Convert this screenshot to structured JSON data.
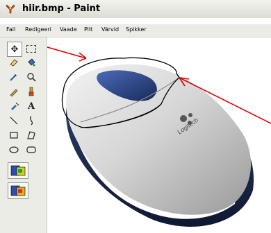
{
  "window": {
    "title": "hiir.bmp - Paint"
  },
  "menu": {
    "items": [
      "Fail",
      "Redigeeri",
      "Vaade",
      "Pilt",
      "Värvid",
      "Spikker"
    ]
  },
  "toolbox": {
    "tools": [
      {
        "name": "free-form-select-icon",
        "glyph": "✥"
      },
      {
        "name": "select-icon",
        "glyph": "▭"
      },
      {
        "name": "eraser-icon",
        "glyph": "⌫"
      },
      {
        "name": "fill-icon",
        "glyph": "♦"
      },
      {
        "name": "color-picker-icon",
        "glyph": "✎"
      },
      {
        "name": "magnifier-icon",
        "glyph": "🔍"
      },
      {
        "name": "pencil-icon",
        "glyph": "✏"
      },
      {
        "name": "brush-icon",
        "glyph": "♜"
      },
      {
        "name": "airbrush-icon",
        "glyph": "✺"
      },
      {
        "name": "text-icon",
        "glyph": "A"
      },
      {
        "name": "line-icon",
        "glyph": "╲"
      },
      {
        "name": "curve-icon",
        "glyph": "∫"
      },
      {
        "name": "rectangle-icon",
        "glyph": "□"
      },
      {
        "name": "polygon-icon",
        "glyph": "▱"
      },
      {
        "name": "ellipse-icon",
        "glyph": "◯"
      },
      {
        "name": "rounded-rectangle-icon",
        "glyph": "▢"
      }
    ]
  },
  "canvas": {
    "brand_text": "Logitech"
  },
  "colors": {
    "annotation": "#e00000",
    "outline": "#000000"
  }
}
